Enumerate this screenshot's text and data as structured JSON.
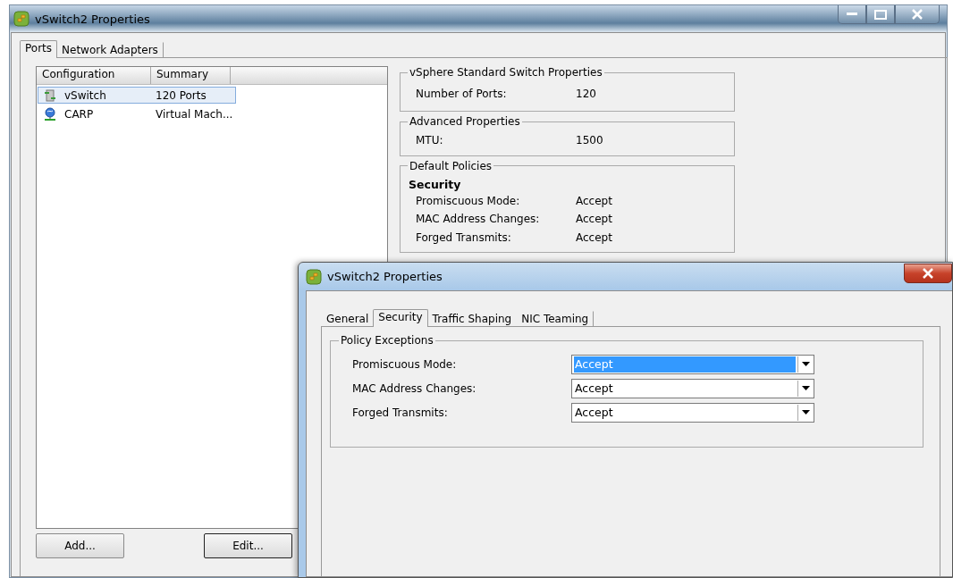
{
  "back_window": {
    "title": "vSwitch2 Properties",
    "tabs": [
      {
        "label": "Ports",
        "selected": true
      },
      {
        "label": "Network Adapters",
        "selected": false
      }
    ],
    "list": {
      "columns": [
        "Configuration",
        "Summary"
      ],
      "rows": [
        {
          "kind": "switch",
          "configuration": "vSwitch",
          "summary": "120 Ports",
          "selected": true
        },
        {
          "kind": "network",
          "configuration": "CARP",
          "summary": "Virtual Mach...",
          "selected": false
        }
      ]
    },
    "groups": [
      {
        "title": "vSphere Standard Switch Properties",
        "rows": [
          {
            "label": "Number of Ports:",
            "value": "120"
          }
        ]
      },
      {
        "title": "Advanced Properties",
        "rows": [
          {
            "label": "MTU:",
            "value": "1500"
          }
        ]
      },
      {
        "title": "Default Policies",
        "heading": "Security",
        "rows": [
          {
            "label": "Promiscuous Mode:",
            "value": "Accept"
          },
          {
            "label": "MAC Address Changes:",
            "value": "Accept"
          },
          {
            "label": "Forged Transmits:",
            "value": "Accept"
          }
        ]
      }
    ],
    "buttons": [
      {
        "label": "Add...",
        "default": false
      },
      {
        "label": "Edit...",
        "default": true
      }
    ]
  },
  "dialog": {
    "title": "vSwitch2 Properties",
    "tabs": [
      {
        "label": "General",
        "selected": false
      },
      {
        "label": "Security",
        "selected": true
      },
      {
        "label": "Traffic Shaping",
        "selected": false
      },
      {
        "label": "NIC Teaming",
        "selected": false
      }
    ],
    "group": {
      "title": "Policy Exceptions",
      "rows": [
        {
          "label": "Promiscuous Mode:",
          "value": "Accept",
          "focused": true
        },
        {
          "label": "MAC Address Changes:",
          "value": "Accept",
          "focused": false
        },
        {
          "label": "Forged Transmits:",
          "value": "Accept",
          "focused": false
        }
      ]
    }
  }
}
